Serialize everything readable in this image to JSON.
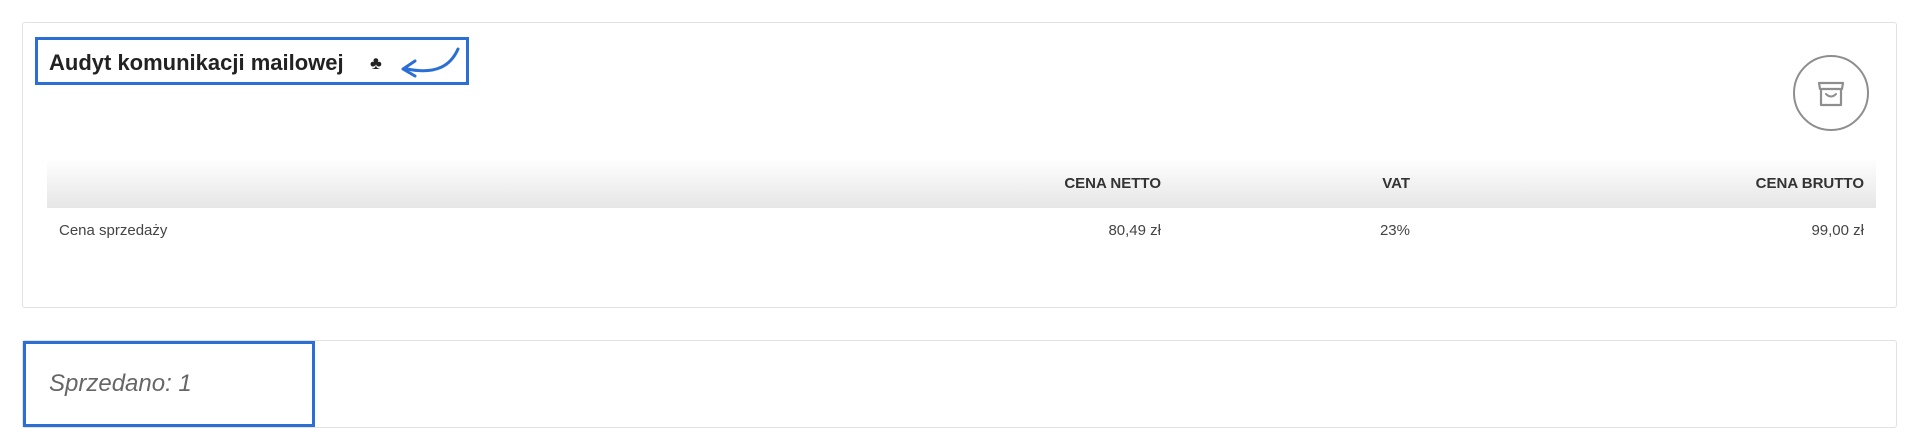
{
  "product": {
    "title": "Audyt komunikacji mailowej",
    "title_icon": "club-icon",
    "title_icon_glyph": "♣",
    "annotation_icon": "curved-arrow-icon",
    "cart_icon": "shopping-bag-icon"
  },
  "price_table": {
    "headers": {
      "label": "",
      "net": "CENA NETTO",
      "vat": "VAT",
      "gross": "CENA BRUTTO"
    },
    "rows": [
      {
        "label": "Cena sprzedaży",
        "net": "80,49 zł",
        "vat": "23%",
        "gross": "99,00 zł"
      }
    ]
  },
  "sold": {
    "text": "Sprzedano: 1"
  },
  "colors": {
    "highlight": "#2b6fd6",
    "border": "#e2e2e2",
    "icon_gray": "#8e8e8e"
  }
}
